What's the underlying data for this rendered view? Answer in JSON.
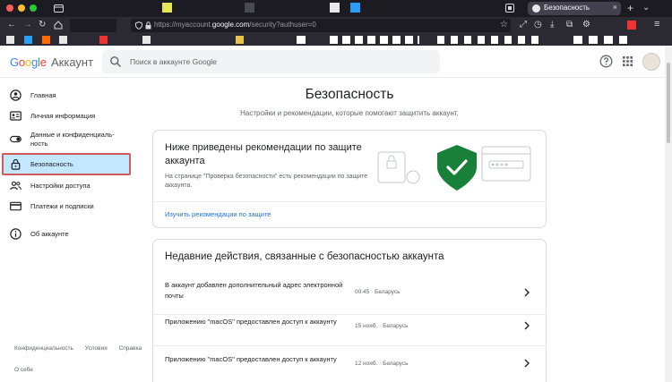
{
  "browser": {
    "tab_title": "Безопасность",
    "url_prefix": "https://myaccount.",
    "url_domain": "google.com",
    "url_suffix": "/security?authuser=0",
    "colors": {
      "chrome_bg": "#1c1b22",
      "toolbar_bg": "#2b2a33",
      "tab_active": "#42414d"
    }
  },
  "header": {
    "logo": {
      "G": "G",
      "o1": "o",
      "o2": "o",
      "g": "g",
      "l": "l",
      "e": "e"
    },
    "product": "Аккаунт",
    "search_placeholder": "Поиск в аккаунте Google"
  },
  "sidebar": {
    "items": [
      {
        "label": "Главная",
        "icon": "person-circle-icon"
      },
      {
        "label": "Личная информация",
        "icon": "id-card-icon"
      },
      {
        "label": "Данные и конфиденциаль-",
        "label2": "ность",
        "icon": "toggle-icon"
      },
      {
        "label": "Безопасность",
        "icon": "lock-icon"
      },
      {
        "label": "Настройки доступа",
        "icon": "people-icon"
      },
      {
        "label": "Платежи и подписки",
        "icon": "credit-card-icon"
      },
      {
        "label": "Об аккаунте",
        "icon": "info-icon"
      }
    ],
    "active_index": 3,
    "footer": {
      "privacy": "Конфиденциальность",
      "terms": "Условия",
      "help": "Справка",
      "about": "О себе"
    }
  },
  "main": {
    "title": "Безопасность",
    "subtitle": "Настройки и рекомендации, которые помогают защитить аккаунт.",
    "recommendations_card": {
      "title": "Ниже приведены рекомендации по защите аккаунта",
      "text": "На странице \"Проверка безопасности\" есть рекомендации по защите аккаунта.",
      "link": "Изучить рекомендации по защите"
    },
    "activity_card": {
      "title": "Недавние действия, связанные с безопасностью аккаунта",
      "rows": [
        {
          "text": "В аккаунт добавлен дополнительный адрес электронной почты",
          "meta": "00:45 · Беларусь"
        },
        {
          "text": "Приложению \"macOS\" предоставлен доступ к аккаунту",
          "meta": "15 нояб. · Беларусь"
        },
        {
          "text": "Приложению \"macOS\" предоставлен доступ к аккаунту",
          "meta": "12 нояб. · Беларусь"
        }
      ]
    },
    "colors": {
      "accent": "#1a73e8",
      "active_bg": "#c2e7ff",
      "highlight_border": "#d25a5a",
      "shield": "#188038"
    }
  }
}
